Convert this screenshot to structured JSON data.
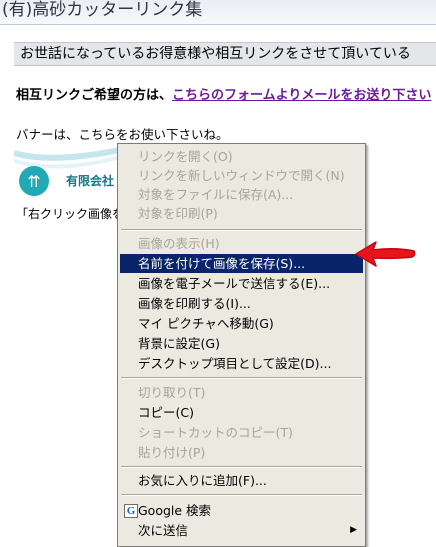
{
  "page": {
    "title": "(有)高砂カッターリンク集",
    "heading": "お世話になっているお得意様や相互リンクをさせて頂いている",
    "request_prefix": "相互リンクご希望の方は、",
    "request_link": "こちらのフォームよりメールをお送り下さい",
    "banner_note": "バナーは、こちらをお使い下さいね。",
    "banner_text": "有限会社",
    "instruction": "「右クリック画像を"
  },
  "context_menu": {
    "items": [
      {
        "label": "リンクを開く(O)",
        "disabled": true
      },
      {
        "label": "リンクを新しいウィンドウで開く(N)",
        "disabled": true
      },
      {
        "label": "対象をファイルに保存(A)...",
        "disabled": true
      },
      {
        "label": "対象を印刷(P)",
        "disabled": true
      },
      {
        "label": "画像の表示(H)",
        "disabled": true
      },
      {
        "label": "名前を付けて画像を保存(S)...",
        "disabled": false,
        "highlight": true
      },
      {
        "label": "画像を電子メールで送信する(E)...",
        "disabled": false
      },
      {
        "label": "画像を印刷する(I)...",
        "disabled": false
      },
      {
        "label": "マイ ピクチャへ移動(G)",
        "disabled": false
      },
      {
        "label": "背景に設定(G)",
        "disabled": false
      },
      {
        "label": "デスクトップ項目として設定(D)...",
        "disabled": false
      },
      {
        "label": "切り取り(T)",
        "disabled": true
      },
      {
        "label": "コピー(C)",
        "disabled": false
      },
      {
        "label": "ショートカットのコピー(T)",
        "disabled": true
      },
      {
        "label": "貼り付け(P)",
        "disabled": true
      },
      {
        "label": "お気に入りに追加(F)...",
        "disabled": false
      },
      {
        "label": "Google 検索",
        "disabled": false,
        "icon": "google-icon"
      },
      {
        "label": "次に送信",
        "disabled": false,
        "submenu": true
      }
    ]
  },
  "colors": {
    "highlight_bg": "#0a246a",
    "menu_bg": "#ebe9e0",
    "disabled_text": "#a8a497",
    "link": "#6a1b9a",
    "annotation_arrow": "#e8141c"
  }
}
